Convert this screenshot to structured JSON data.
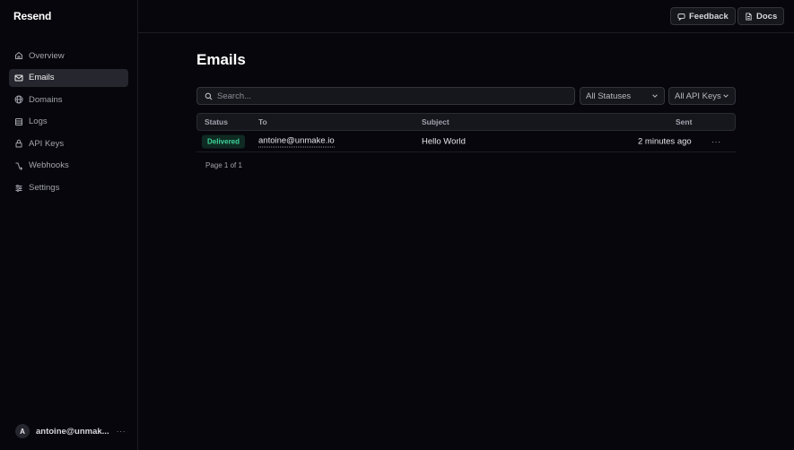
{
  "app": {
    "logo": "Resend"
  },
  "sidebar": {
    "items": [
      {
        "label": "Overview",
        "icon": "home-icon"
      },
      {
        "label": "Emails",
        "icon": "mail-icon",
        "active": true
      },
      {
        "label": "Domains",
        "icon": "globe-icon"
      },
      {
        "label": "Logs",
        "icon": "logs-icon"
      },
      {
        "label": "API Keys",
        "icon": "lock-icon"
      },
      {
        "label": "Webhooks",
        "icon": "webhook-icon"
      },
      {
        "label": "Settings",
        "icon": "settings-sliders-icon"
      }
    ],
    "user": {
      "initial": "A",
      "name": "antoine@unmak...",
      "more": "···"
    }
  },
  "topbar": {
    "feedback_label": "Feedback",
    "docs_label": "Docs"
  },
  "main": {
    "title": "Emails",
    "search_placeholder": "Search...",
    "status_filter": "All Statuses",
    "api_key_filter": "All API Keys"
  },
  "table": {
    "headers": {
      "status": "Status",
      "to": "To",
      "subject": "Subject",
      "sent": "Sent"
    },
    "rows": [
      {
        "status": "Delivered",
        "to": "antoine@unmake.io",
        "subject": "Hello World",
        "sent": "2 minutes ago",
        "more": "···"
      }
    ]
  },
  "pagination": "Page 1 of 1",
  "colors": {
    "accent_delivered": "#3ed69a",
    "background": "#07060c"
  }
}
